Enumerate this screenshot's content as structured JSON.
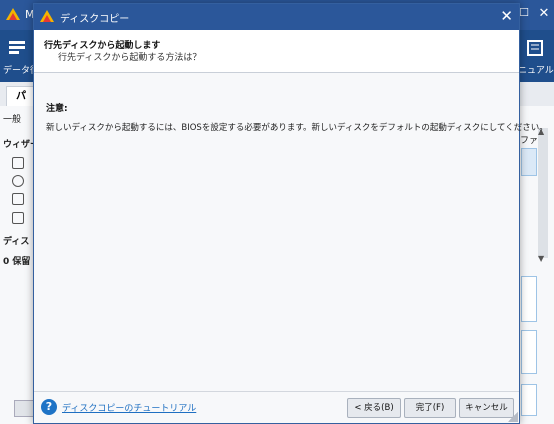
{
  "background": {
    "title": "M",
    "min_glyph": "—",
    "max_glyph": "☐",
    "close_glyph": "✕",
    "toolbar": {
      "left_label": "データ復",
      "right_label": "ニュアル"
    },
    "tab_label": "パ",
    "side": {
      "general": "一般",
      "wizard": "ウィザー",
      "disk": "ディス",
      "saved": "0 保留"
    },
    "right_header": "ファイ"
  },
  "dialog": {
    "title": "ディスクコピー",
    "close_glyph": "✕",
    "header_title": "行先ディスクから起動します",
    "header_subtitle": "行先ディスクから起動する方法は？",
    "note_label": "注意:",
    "note_text": "新しいディスクから起動するには、BIOSを設定する必要があります。新しいディスクをデフォルトの起動ディスクにしてください。",
    "help_glyph": "?",
    "help_link": "ディスクコピーのチュートリアル",
    "buttons": {
      "back": "< 戻る(B)",
      "finish": "完了(F)",
      "cancel": "キャンセル"
    }
  },
  "colors": {
    "titlebar": "#2b579a",
    "toolbar": "#1f4e8c",
    "link": "#1e6fc2"
  }
}
